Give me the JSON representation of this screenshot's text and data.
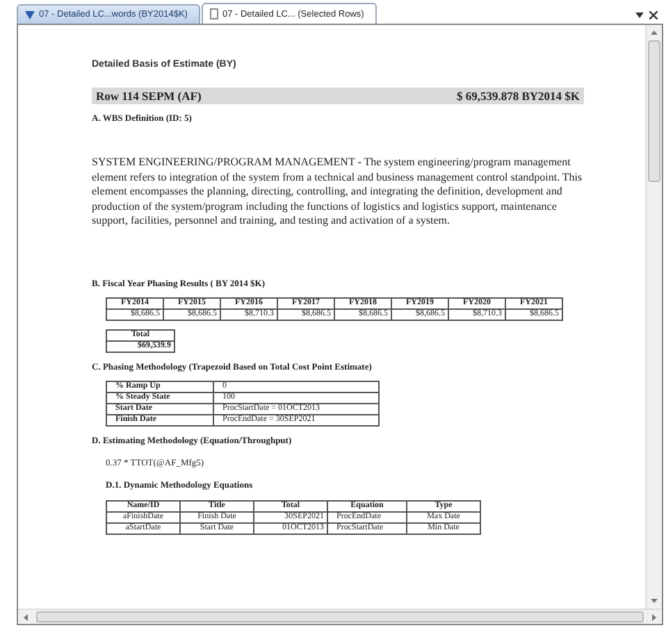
{
  "tabs": [
    {
      "label": "07 - Detailed LC...words (BY2014$K)",
      "selected": false,
      "kind": "filter"
    },
    {
      "label": "07 - Detailed LC... (Selected Rows)",
      "selected": true,
      "kind": "document"
    }
  ],
  "document": {
    "title": "Detailed Basis of Estimate (BY)",
    "row_header": {
      "label": "Row 114 SEPM (AF)",
      "amount": "$ 69,539.878 BY2014 $K"
    },
    "wbs": {
      "heading": "A. WBS Definition (ID: 5)",
      "text": "SYSTEM ENGINEERING/PROGRAM MANAGEMENT - The system engineering/program management element refers to integration of the system from a technical and business management control standpoint.  This element encompasses the planning, directing, controlling, and integrating the definition, development and production of the system/program including the functions of logistics and logistics support, maintenance support, facilities, personnel and training, and testing and activation of a system."
    },
    "phasing": {
      "heading": "B. Fiscal Year Phasing Results ( BY 2014 $K)",
      "columns": [
        "FY2014",
        "FY2015",
        "FY2016",
        "FY2017",
        "FY2018",
        "FY2019",
        "FY2020",
        "FY2021"
      ],
      "values": [
        "$8,686.5",
        "$8,686.5",
        "$8,710.3",
        "$8,686.5",
        "$8,686.5",
        "$8,686.5",
        "$8,710.3",
        "$8,686.5"
      ],
      "total_label": "Total",
      "total_value": "$69,539.9"
    },
    "methodology": {
      "heading": "C. Phasing Methodology (Trapezoid Based on Total Cost Point Estimate)",
      "rows": [
        {
          "label": "% Ramp Up",
          "value": "0"
        },
        {
          "label": "% Steady State",
          "value": "100"
        },
        {
          "label": "Start Date",
          "value": "ProcStartDate = 01OCT2013"
        },
        {
          "label": "Finish Date",
          "value": "ProcEndDate = 30SEP2021"
        }
      ]
    },
    "estimating": {
      "heading": "D. Estimating Methodology (Equation/Throughput)",
      "formula": "0.37 * TTOT(@AF_Mfg5)"
    },
    "dynamic": {
      "heading": "D.1. Dynamic Methodology Equations",
      "columns": [
        "Name/ID",
        "Title",
        "Total",
        "Equation",
        "Type"
      ],
      "rows": [
        [
          "aFinishDate",
          "Finish Date",
          "30SEP2021",
          "ProcEndDate",
          "Max Date"
        ],
        [
          "aStartDate",
          "Start Date",
          "01OCT2013",
          "ProcStartDate",
          "Min Date"
        ]
      ]
    }
  }
}
